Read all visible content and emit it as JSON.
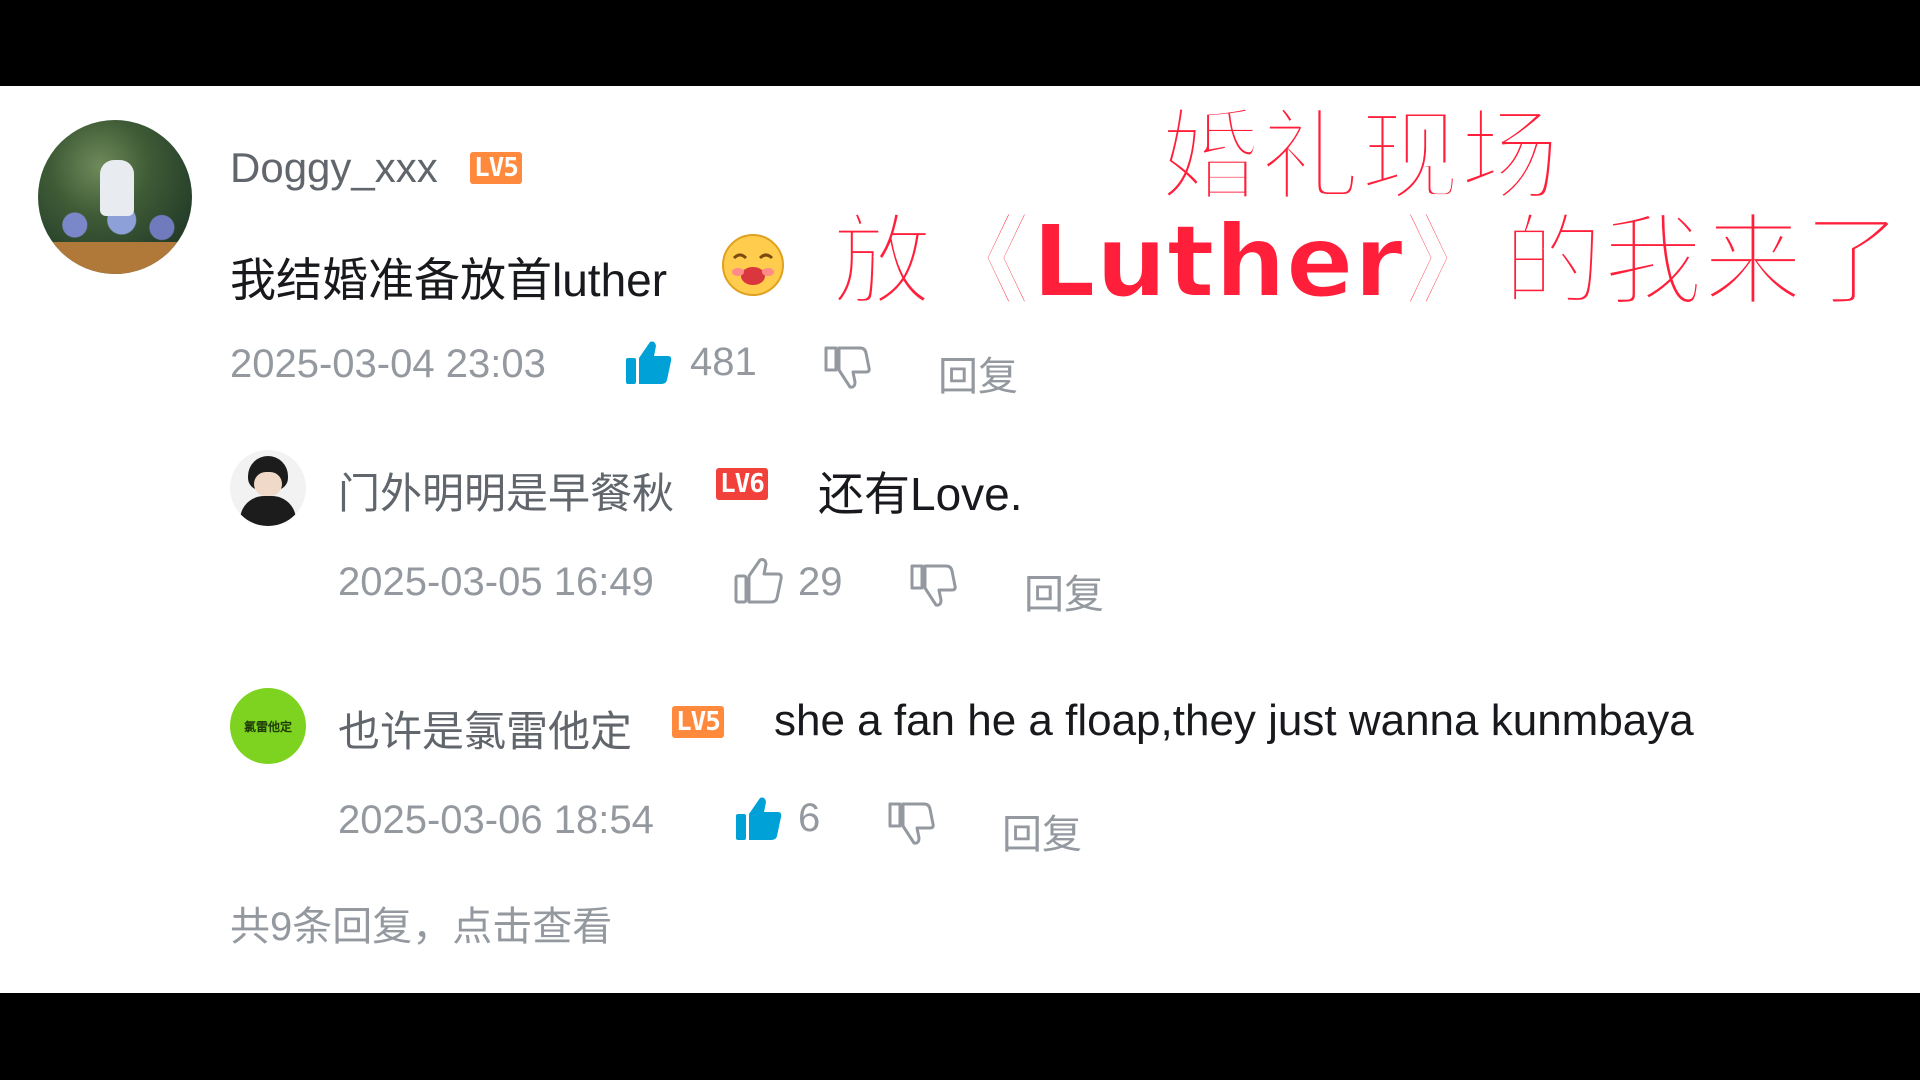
{
  "overlay": {
    "line1": "婚礼现场",
    "line2": "放《Luther》的我来了",
    "color": "#ff1f3a"
  },
  "main_comment": {
    "username": "Doggy_xxx",
    "level": "LV5",
    "text": "我结婚准备放首luther",
    "emoji": "emoji-sweat-laugh",
    "time": "2025-03-04 23:03",
    "likes": "481",
    "liked": true,
    "reply_label": "回复"
  },
  "replies": [
    {
      "username": "门外明明是早餐秋",
      "level": "LV6",
      "text": "还有Love.",
      "time": "2025-03-05 16:49",
      "likes": "29",
      "liked": false,
      "reply_label": "回复"
    },
    {
      "username": "也许是氯雷他定",
      "level": "LV5",
      "text": "she a fan he a floap,they just wanna kunmbaya",
      "avatar_text": "氯雷他定",
      "time": "2025-03-06 18:54",
      "likes": "6",
      "liked": true,
      "reply_label": "回复"
    }
  ],
  "more_replies": "共9条回复，点击查看",
  "colors": {
    "like_active": "#00a1d6",
    "meta_gray": "#9499a0",
    "username_gray": "#61666d",
    "avatar_green": "#7ed321"
  }
}
